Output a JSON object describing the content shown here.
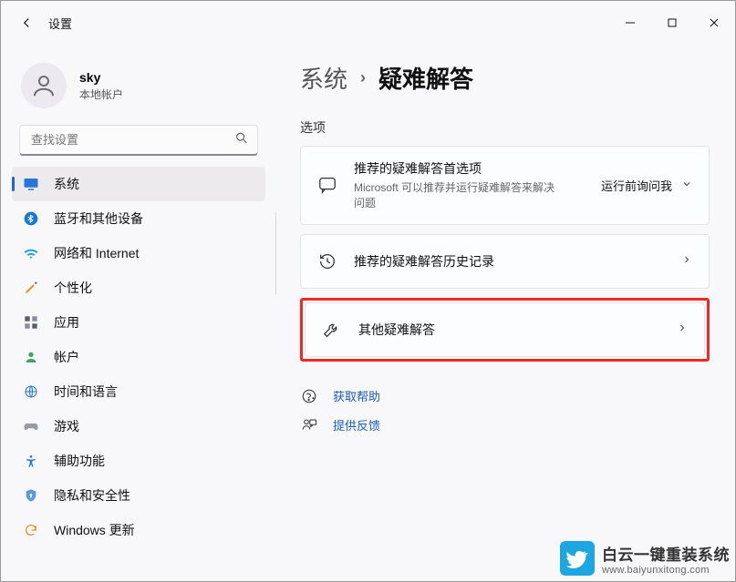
{
  "window": {
    "title": "设置"
  },
  "user": {
    "name": "sky",
    "account_type": "本地帐户"
  },
  "search": {
    "placeholder": "查找设置"
  },
  "nav": {
    "items": [
      {
        "label": "系统"
      },
      {
        "label": "蓝牙和其他设备"
      },
      {
        "label": "网络和 Internet"
      },
      {
        "label": "个性化"
      },
      {
        "label": "应用"
      },
      {
        "label": "帐户"
      },
      {
        "label": "时间和语言"
      },
      {
        "label": "游戏"
      },
      {
        "label": "辅助功能"
      },
      {
        "label": "隐私和安全性"
      },
      {
        "label": "Windows 更新"
      }
    ]
  },
  "breadcrumb": {
    "parent": "系统",
    "current": "疑难解答"
  },
  "section": {
    "label": "选项"
  },
  "cards": {
    "pref": {
      "title": "推荐的疑难解答首选项",
      "sub": "Microsoft 可以推荐并运行疑难解答来解决问题",
      "value": "运行前询问我"
    },
    "history": {
      "title": "推荐的疑难解答历史记录"
    },
    "other": {
      "title": "其他疑难解答"
    }
  },
  "help": {
    "get_help": "获取帮助",
    "feedback": "提供反馈"
  },
  "watermark": {
    "line1": "白云一键重装系统",
    "line2": "www.baiyunxitong.com"
  }
}
